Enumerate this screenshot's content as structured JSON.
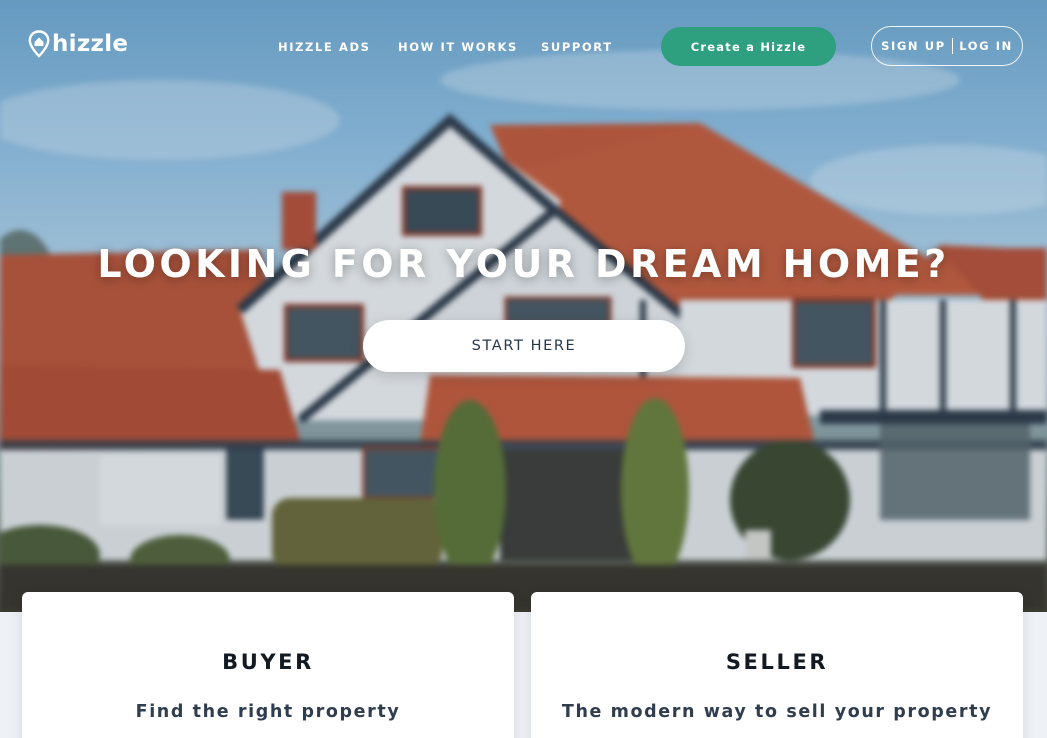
{
  "brand": {
    "logo_text": "hizzle"
  },
  "nav": {
    "links": [
      {
        "label": "HIZZLE ADS"
      },
      {
        "label": "HOW IT WORKS"
      },
      {
        "label": "SUPPORT"
      }
    ],
    "create_button": "Create a Hizzle",
    "sign_up": "SIGN UP",
    "log_in": "LOG IN"
  },
  "hero": {
    "headline": "LOOKING FOR YOUR DREAM HOME?",
    "start_button": "START HERE"
  },
  "cards": {
    "buyer": {
      "title": "BUYER",
      "subtitle": "Find the right property"
    },
    "seller": {
      "title": "SELLER",
      "subtitle": "The modern way to sell your property"
    }
  },
  "colors": {
    "accent_green": "#2e9f7f",
    "roof": "#b8563a",
    "sky": "#8dbde0",
    "card_title": "#141a22",
    "card_subtitle": "#2f3d4f"
  },
  "icons": {
    "logo_mark": "location-pin-icon"
  }
}
